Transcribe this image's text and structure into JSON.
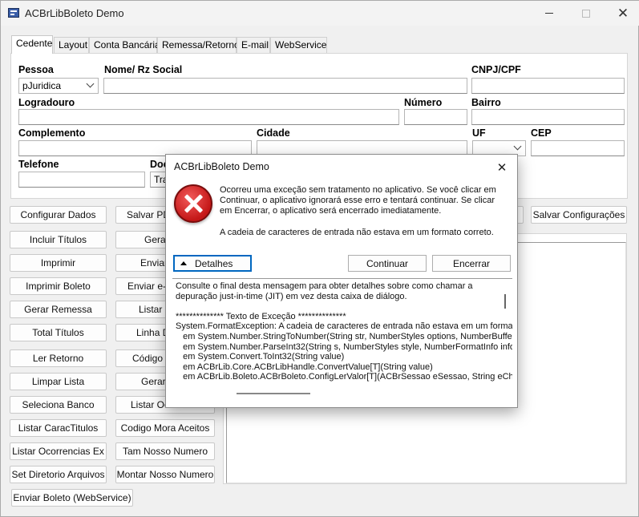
{
  "window": {
    "title": "ACBrLibBoleto Demo"
  },
  "tabs": [
    "Cedente",
    "Layout",
    "Conta Bancária",
    "Remessa/Retorno",
    "E-mail",
    "WebService"
  ],
  "form": {
    "pessoa_label": "Pessoa",
    "pessoa_value": "pJuridica",
    "nome_label": "Nome/ Rz Social",
    "cnpj_label": "CNPJ/CPF",
    "logradouro_label": "Logradouro",
    "numero_label": "Número",
    "bairro_label": "Bairro",
    "complemento_label": "Complemento",
    "cidade_label": "Cidade",
    "uf_label": "UF",
    "cep_label": "CEP",
    "telefone_label": "Telefone",
    "doc_label": "Doc",
    "doc_value": "Trad"
  },
  "buttons_left": [
    "Configurar Dados",
    "Incluir Títulos",
    "Imprimir",
    "Imprimir Boleto",
    "Gerar Remessa",
    "Total Títulos",
    "Ler Retorno",
    "Limpar Lista",
    "Seleciona Banco",
    "Listar CaracTitulos",
    "Listar Ocorrencias Ex",
    "Set Diretorio Arquivos",
    "Enviar Boleto (WebService)"
  ],
  "buttons_middle": [
    "Salvar PDF",
    "Gerar",
    "Enviar",
    "Enviar e-m",
    "Listar B",
    "Linha Di",
    "Código d",
    "Gerar H",
    "Listar Oco",
    "Codigo Mora Aceitos",
    "Tam Nosso Numero",
    "Montar Nosso Numero"
  ],
  "salvar_config_label": "Salvar Configurações",
  "dialog": {
    "title": "ACBrLibBoleto Demo",
    "close_glyph": "✕",
    "message": "Ocorreu uma exceção sem tratamento no aplicativo. Se você clicar em Continuar, o aplicativo ignorará esse erro e tentará continuar. Se clicar em Encerrar, o aplicativo será encerrado imediatamente.",
    "message2": "A cadeia de caracteres de entrada não estava em um formato correto.",
    "details_label": "Detalhes",
    "continue_label": "Continuar",
    "quit_label": "Encerrar",
    "details_text": "Consulte o final desta mensagem para obter detalhes sobre como chamar a\ndepuração just-in-time (JIT) em vez desta caixa de diálogo.\n\n************** Texto de Exceção **************\nSystem.FormatException: A cadeia de caracteres de entrada não estava em um forma\n   em System.Number.StringToNumber(String str, NumberStyles options, NumberBuffe\n   em System.Number.ParseInt32(String s, NumberStyles style, NumberFormatInfo info\n   em System.Convert.ToInt32(String value)\n   em ACBrLib.Core.ACBrLibHandle.ConvertValue[T](String value)\n   em ACBrLib.Boleto.ACBrBoleto.ConfigLerValor[T](ACBrSessao eSessao, String eCh"
  }
}
